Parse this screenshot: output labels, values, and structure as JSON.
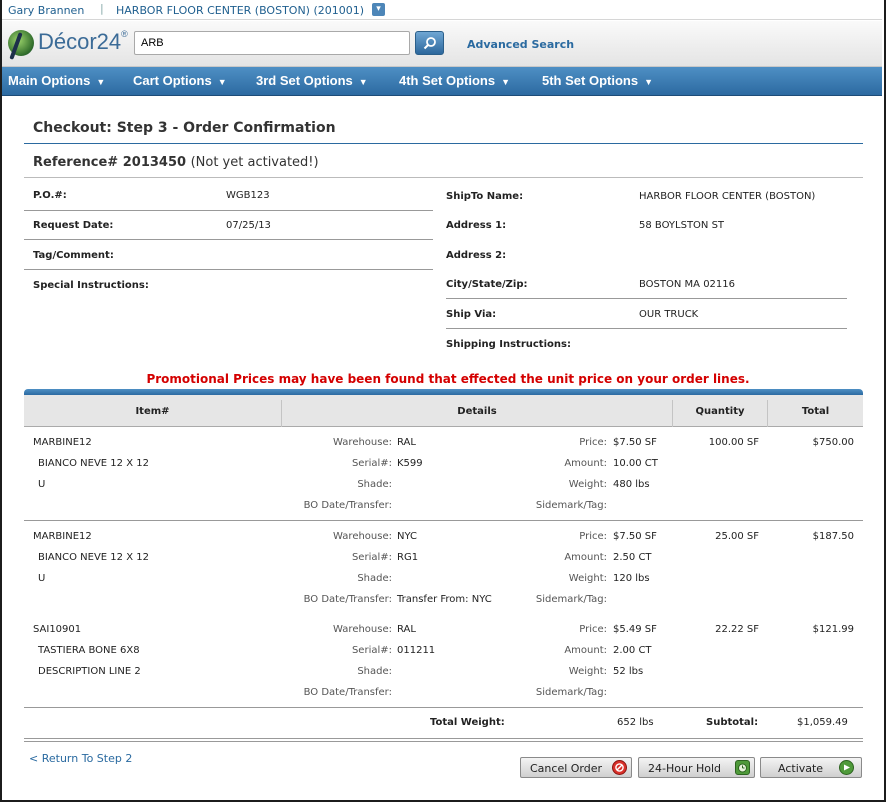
{
  "user": {
    "name": "Gary Brannen",
    "separator": "|",
    "store": "HARBOR FLOOR CENTER (BOSTON) (201001)"
  },
  "header": {
    "logo_text": "Décor24",
    "logo_mark": "®",
    "search_value": "ARB",
    "advanced_search": "Advanced Search"
  },
  "nav": {
    "items": [
      "Main Options",
      "Cart Options",
      "3rd Set Options",
      "4th Set Options",
      "5th Set Options"
    ],
    "caret": "▼"
  },
  "page": {
    "title": "Checkout: Step 3 - Order Confirmation",
    "reference_label": "Reference# 2013450",
    "reference_status": "(Not yet activated!)"
  },
  "order_left": {
    "po_label": "P.O.#:",
    "po_value": "WGB123",
    "request_date_label": "Request Date:",
    "request_date_value": "07/25/13",
    "tag_label": "Tag/Comment:",
    "tag_value": "",
    "special_label": "Special Instructions:",
    "special_value": ""
  },
  "order_right": {
    "shipto_label": "ShipTo Name:",
    "shipto_value": "HARBOR FLOOR CENTER (BOSTON)",
    "addr1_label": "Address 1:",
    "addr1_value": "58 BOYLSTON ST",
    "addr2_label": "Address 2:",
    "addr2_value": "",
    "city_label": "City/State/Zip:",
    "city_value": "BOSTON MA 02116",
    "shipvia_label": "Ship Via:",
    "shipvia_value": "OUR TRUCK",
    "shipinst_label": "Shipping Instructions:",
    "shipinst_value": ""
  },
  "promo_message": "Promotional Prices may have been found that effected the unit price on your order lines.",
  "table": {
    "headers": {
      "item": "Item#",
      "details": "Details",
      "quantity": "Quantity",
      "total": "Total"
    },
    "labels": {
      "warehouse": "Warehouse:",
      "serial": "Serial#:",
      "shade": "Shade:",
      "bo": "BO Date/Transfer:",
      "price": "Price:",
      "amount": "Amount:",
      "weight": "Weight:",
      "sidemark": "Sidemark/Tag:"
    },
    "rows": [
      {
        "item": "MARBINE12",
        "desc1": "BIANCO NEVE 12 X 12",
        "desc2": "U",
        "warehouse": "RAL",
        "serial": "K599",
        "shade": "",
        "bo": "",
        "price": "$7.50 SF",
        "amount": "10.00 CT",
        "weight": "480 lbs",
        "sidemark": "",
        "quantity": "100.00 SF",
        "total": "$750.00"
      },
      {
        "item": "MARBINE12",
        "desc1": "BIANCO NEVE 12 X 12",
        "desc2": "U",
        "warehouse": "NYC",
        "serial": "RG1",
        "shade": "",
        "bo": "Transfer From: NYC",
        "price": "$7.50 SF",
        "amount": "2.50 CT",
        "weight": "120 lbs",
        "sidemark": "",
        "quantity": "25.00 SF",
        "total": "$187.50"
      },
      {
        "item": "SAI10901",
        "desc1": "TASTIERA BONE 6X8",
        "desc2": "DESCRIPTION LINE 2",
        "warehouse": "RAL",
        "serial": "011211",
        "shade": "",
        "bo": "",
        "price": "$5.49 SF",
        "amount": "2.00 CT",
        "weight": "52 lbs",
        "sidemark": "",
        "quantity": "22.22 SF",
        "total": "$121.99"
      }
    ],
    "totals": {
      "weight_label": "Total Weight:",
      "weight_value": "652 lbs",
      "subtotal_label": "Subtotal:",
      "subtotal_value": "$1,059.49"
    }
  },
  "footer": {
    "return_prefix": "<",
    "return_link": "Return To Step 2",
    "cancel": "Cancel Order",
    "hold": "24-Hour Hold",
    "activate": "Activate"
  },
  "colors": {
    "nav": "#2c6aa1",
    "accent": "#2a6aa0",
    "promo": "#d40000"
  }
}
